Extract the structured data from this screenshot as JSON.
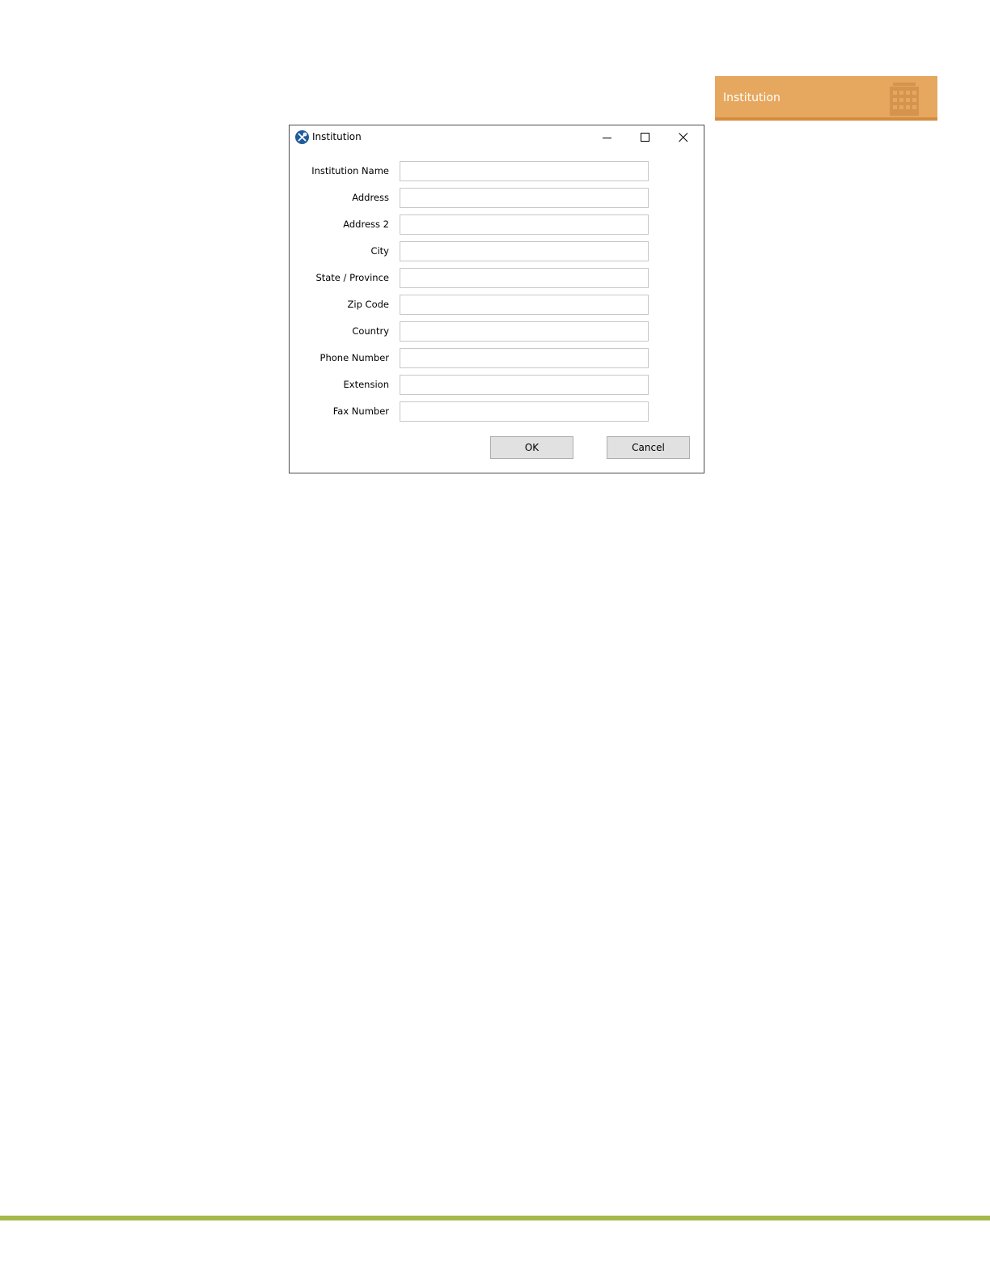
{
  "banner": {
    "label": "Institution",
    "icon": "building-icon",
    "color": "#e6a75e"
  },
  "dialog": {
    "title": "Institution",
    "app_icon": "wrench-screwdriver-icon",
    "controls": {
      "minimize": "minimize-icon",
      "maximize": "maximize-icon",
      "close": "close-icon"
    },
    "fields": [
      {
        "label": "Institution Name",
        "value": "",
        "placeholder": ""
      },
      {
        "label": "Address",
        "value": "",
        "placeholder": ""
      },
      {
        "label": "Address 2",
        "value": "",
        "placeholder": ""
      },
      {
        "label": "City",
        "value": "",
        "placeholder": ""
      },
      {
        "label": "State / Province",
        "value": "",
        "placeholder": ""
      },
      {
        "label": "Zip Code",
        "value": "",
        "placeholder": ""
      },
      {
        "label": "Country",
        "value": "",
        "placeholder": ""
      },
      {
        "label": "Phone Number",
        "value": "",
        "placeholder": ""
      },
      {
        "label": "Extension",
        "value": "",
        "placeholder": ""
      },
      {
        "label": "Fax Number",
        "value": "",
        "placeholder": ""
      }
    ],
    "buttons": {
      "ok": "OK",
      "cancel": "Cancel"
    }
  },
  "footer": {
    "rule_color": "#a4b94a"
  }
}
